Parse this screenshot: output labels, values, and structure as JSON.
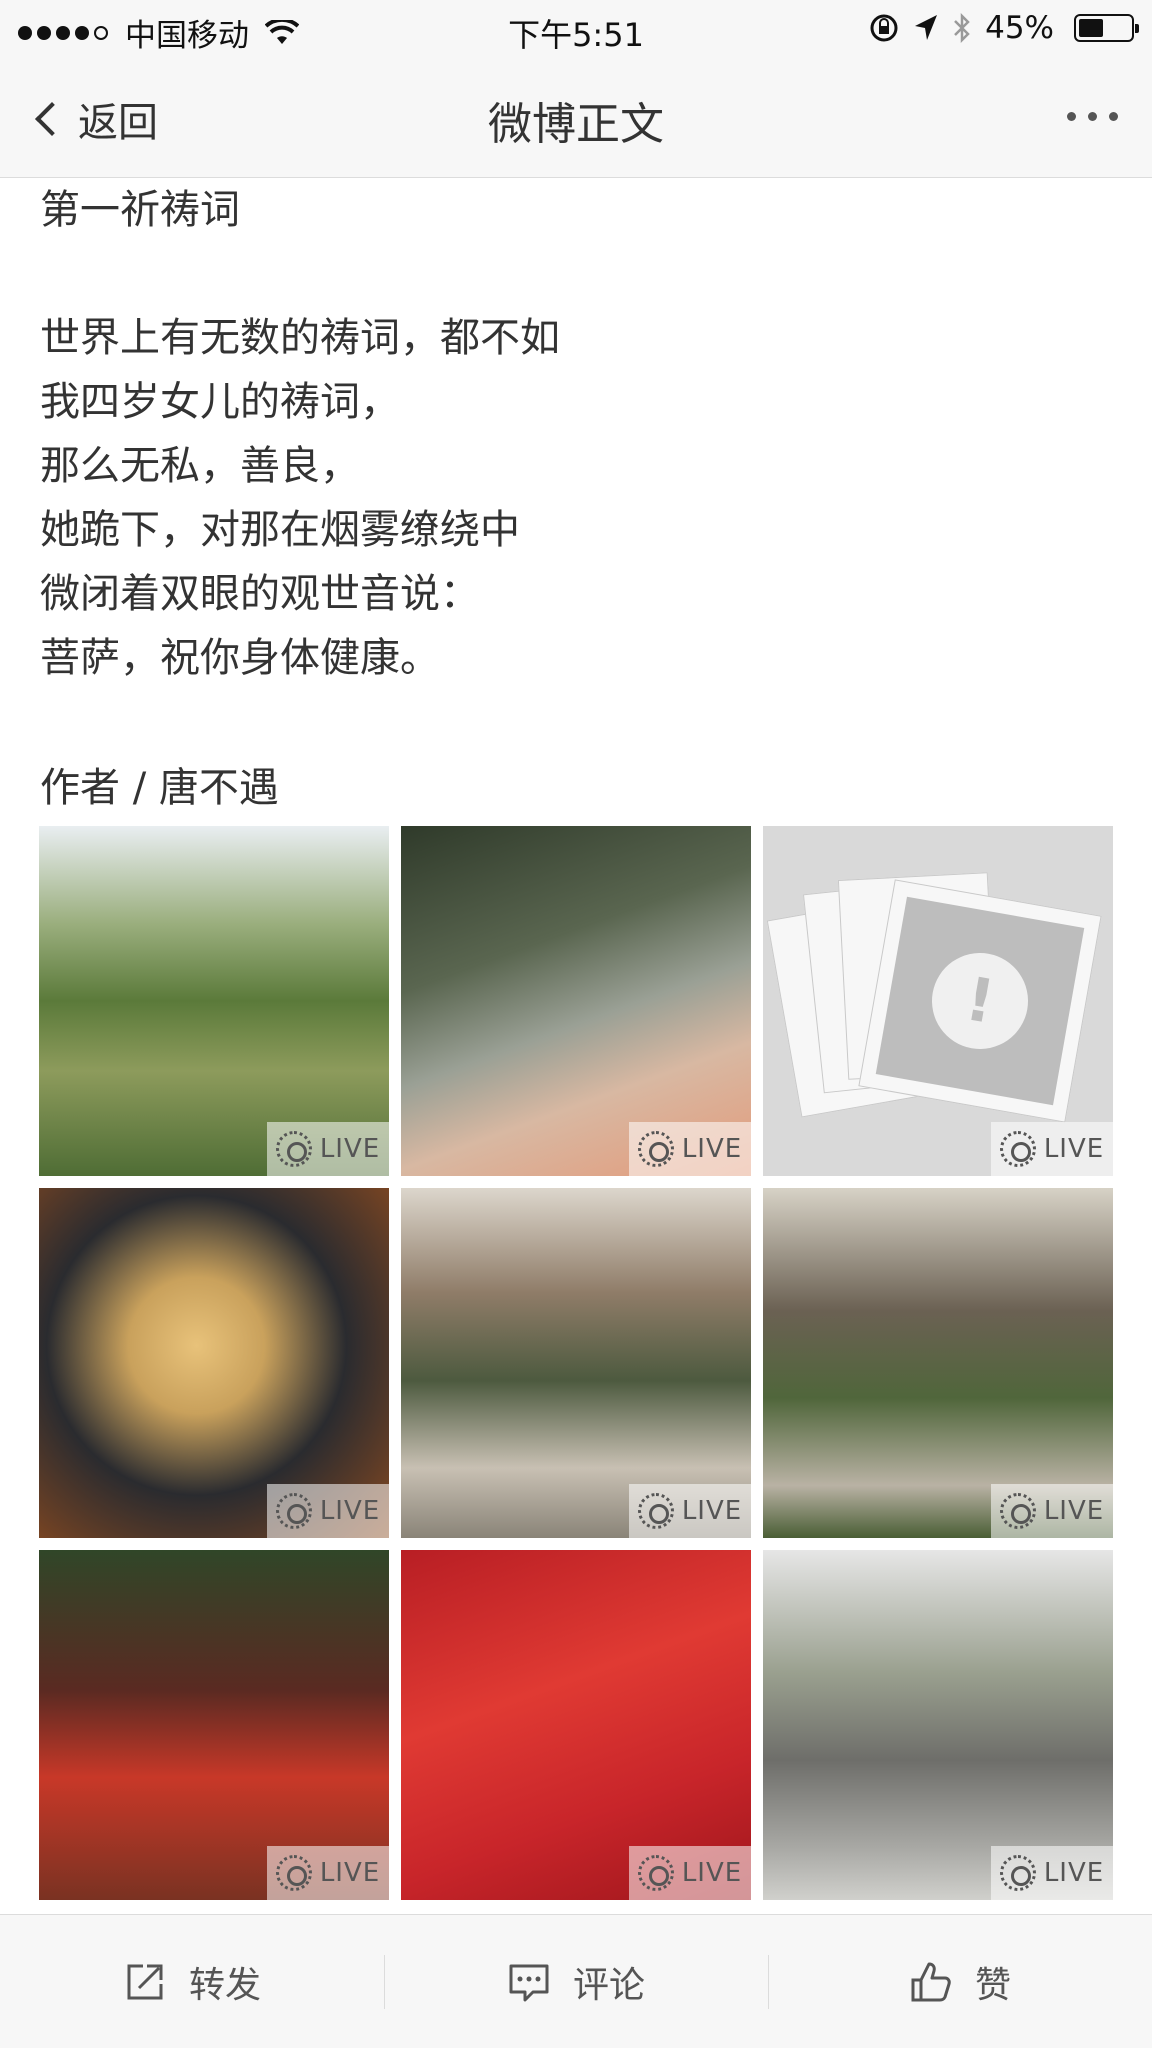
{
  "status_bar": {
    "carrier": "中国移动",
    "time": "下午5:51",
    "battery_percent": "45%"
  },
  "nav": {
    "back_label": "返回",
    "title": "微博正文"
  },
  "post": {
    "title_line": "第一祈祷词",
    "poem_lines": [
      "世界上有无数的祷词，都不如",
      "我四岁女儿的祷词，",
      "那么无私，善良，",
      "她跪下，对那在烟雾缭绕中",
      "微闭着双眼的观世音说：",
      "菩萨，祝你身体健康。"
    ],
    "author_line": "作者 / 唐不遇"
  },
  "images": {
    "live_label": "LIVE",
    "tiles": [
      {
        "id": "1",
        "has_live": true
      },
      {
        "id": "2",
        "has_live": true
      },
      {
        "id": "3",
        "has_live": true,
        "broken": true
      },
      {
        "id": "4",
        "has_live": true
      },
      {
        "id": "5",
        "has_live": true
      },
      {
        "id": "6",
        "has_live": true
      },
      {
        "id": "7",
        "has_live": true
      },
      {
        "id": "8",
        "has_live": true
      },
      {
        "id": "9",
        "has_live": true
      }
    ]
  },
  "toolbar": {
    "repost_label": "转发",
    "comment_label": "评论",
    "like_label": "赞"
  },
  "icons": {
    "back": "chevron-left-icon",
    "more": "more-icon",
    "repost": "share-icon",
    "comment": "comment-icon",
    "like": "thumbs-up-icon",
    "live": "live-photo-icon",
    "broken_image": "broken-image-icon"
  }
}
